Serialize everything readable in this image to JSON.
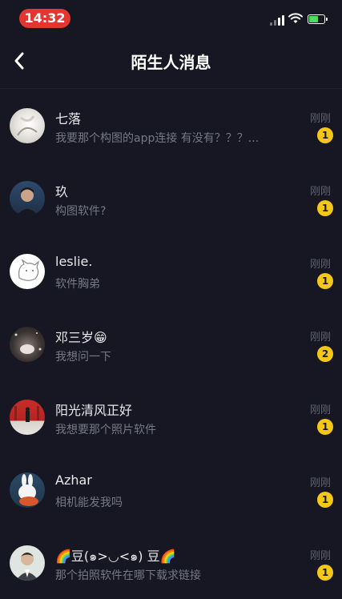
{
  "status_bar": {
    "time": "14:32"
  },
  "header": {
    "title": "陌生人消息",
    "back_icon": "chevron-left-icon"
  },
  "conversations": [
    {
      "name": "七落",
      "preview": "我要那个构图的app连接  有没有？？？...",
      "time": "刚刚",
      "unread": "1"
    },
    {
      "name": "玖",
      "preview": "构图软件?",
      "time": "刚刚",
      "unread": "1"
    },
    {
      "name": "leslie.",
      "preview": "软件胸弟",
      "time": "刚刚",
      "unread": "1"
    },
    {
      "name": "邓三岁😁",
      "preview": "我想问一下",
      "time": "刚刚",
      "unread": "2"
    },
    {
      "name": "阳光清风正好",
      "preview": "我想要那个照片软件",
      "time": "刚刚",
      "unread": "1"
    },
    {
      "name": "Azhar",
      "preview": " 相机能发我吗",
      "time": "刚刚",
      "unread": "1"
    },
    {
      "name": "🌈豆(๑>◡<๑)  豆🌈",
      "preview": "那个拍照软件在哪下载求链接",
      "time": "刚刚",
      "unread": "1"
    }
  ],
  "colors": {
    "background": "#161722",
    "badge": "#f5c818",
    "time_pill": "#e3362f"
  }
}
